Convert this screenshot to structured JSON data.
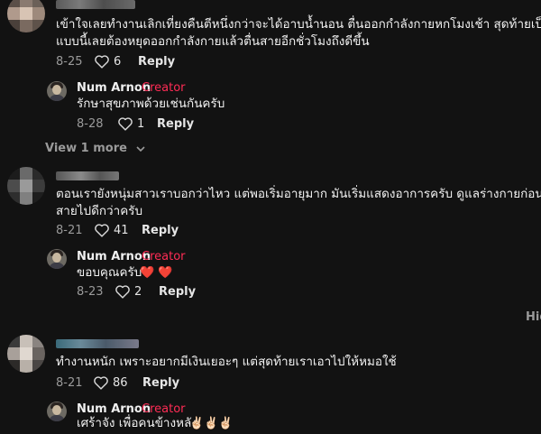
{
  "comments": [
    {
      "text_line1": "เข้าใจเลยทำงานเลิกเที่ยงคืนตีหนึ่งกว่าจะได้อาบน้ำนอน ตื่นออกกำลังกายหกโมงเช้า สุดท้ายเป็น",
      "text_line2": "แบบนี้เลยต้องหยุดออกกำลังกายแล้วตื่นสายอีกชั่วโมงถึงดีขึ้น",
      "date": "8-25",
      "likes": "6",
      "reply_label": "Reply",
      "replies": [
        {
          "name": "Num Arnon",
          "separator": "·",
          "badge": "Creator",
          "text": "รักษาสุขภาพด้วยเช่นกันครับ",
          "date": "8-28",
          "likes": "1",
          "reply_label": "Reply"
        }
      ],
      "view_more": "View 1 more"
    },
    {
      "text_line1": "ตอนเรายังหนุ่มสาวเราบอกว่าไหว แต่พอเริ่มอายุมาก มันเริ่มแสดงอาการครับ ดูแลร่างกายก่อนที่จะ",
      "text_line2": "สายไปดีกว่าครับ",
      "date": "8-21",
      "likes": "41",
      "reply_label": "Reply",
      "replies": [
        {
          "name": "Num Arnon",
          "separator": "·",
          "badge": "Creator",
          "text": "ขอบคุณครับ",
          "emoji": "❤️ ❤️",
          "date": "8-23",
          "likes": "2",
          "reply_label": "Reply"
        }
      ],
      "hide_label": "Hid"
    },
    {
      "text_line1": "ทำงานหนัก เพราะอยากมีเงินเยอะๆ แต่สุดท้ายเราเอาไปให้หมอใช้",
      "date": "8-21",
      "likes": "86",
      "reply_label": "Reply",
      "replies": [
        {
          "name": "Num Arnon",
          "separator": "·",
          "badge": "Creator",
          "text": "เศร้าจัง เพื่อคนข้างหลัง",
          "emoji": "✌🏻✌🏻✌🏻"
        }
      ]
    }
  ],
  "icons": {
    "like": "heart-outline-icon",
    "expand": "chevron-down-icon"
  },
  "colors": {
    "background": "#121212",
    "creator": "#fe2c55",
    "muted": "#9a9a9a"
  }
}
